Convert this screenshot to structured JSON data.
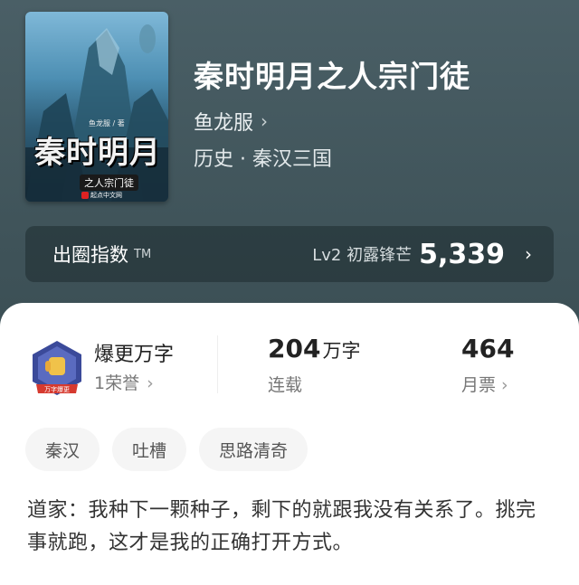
{
  "book": {
    "cover_title": "秦时明月",
    "cover_subtitle": "之人宗门徒",
    "cover_author": "鱼龙服 / 著",
    "cover_publisher": "起点中文网",
    "title": "秦时明月之人宗门徒",
    "author": "鱼龙服",
    "genre": "历史 · 秦汉三国"
  },
  "rank": {
    "label": "出圈指数",
    "trademark": "TM",
    "level": "Lv2 初露锋芒",
    "score": "5,339"
  },
  "stats": {
    "badge_title": "爆更万字",
    "badge_sub": "1荣誉",
    "badge_text": "万字爆更",
    "words_value": "204",
    "words_unit": "万字",
    "words_label": "连载",
    "tickets_value": "464",
    "tickets_label": "月票"
  },
  "tags": [
    "秦汉",
    "吐槽",
    "思路清奇"
  ],
  "intro": "道家：我种下一颗种子，剩下的就跟我没有关系了。挑完事就跑，这才是我的正确打开方式。",
  "colors": {
    "header_bg": "#3e5258",
    "panel_bg": "#ffffff",
    "tag_bg": "#f5f5f5",
    "badge_blue": "#3b4a9a",
    "badge_red": "#d63a2f"
  }
}
